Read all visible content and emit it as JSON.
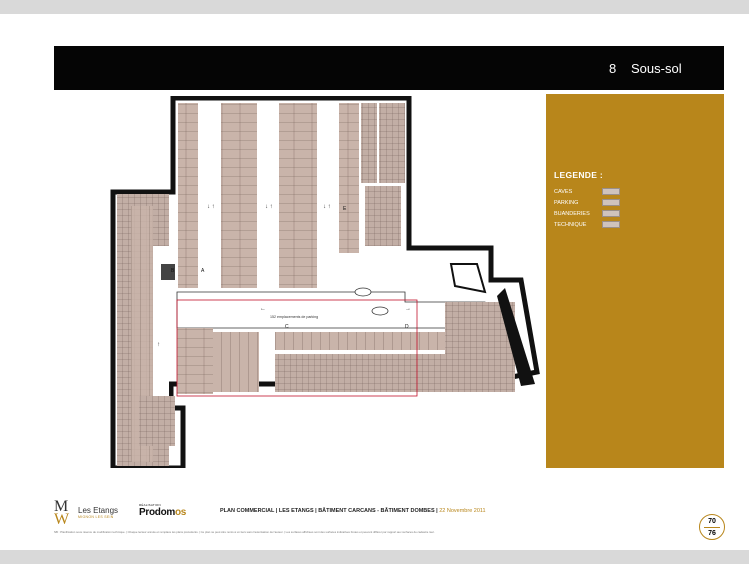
{
  "header": {
    "section_number": "8",
    "section_title": "Sous-sol"
  },
  "legend": {
    "title": "LEGENDE :",
    "items": [
      {
        "label": "CAVES",
        "color": "#cfc3bd"
      },
      {
        "label": "PARKING",
        "color": "#cfc3bd"
      },
      {
        "label": "BUANDERIES",
        "color": "#cfc3bd"
      },
      {
        "label": "TECHNIQUE",
        "color": "#cfc3bd"
      }
    ]
  },
  "plan": {
    "center_label": "152 emplacements de parking",
    "markers": [
      "A",
      "B",
      "C",
      "D",
      "E"
    ]
  },
  "footer": {
    "logo_letters": "MW",
    "brand_name": "Les Etangs",
    "brand_sub": "MIGNON LES SEIN",
    "developer_pre": "RÉALISATION",
    "developer_a": "Prodom",
    "developer_b": "os",
    "plan_line": "PLAN COMMERCIAL | LES ETANGS | BÂTIMENT CARCANS - BÂTIMENT DOMBES |",
    "date": "22 Novembre 2011",
    "disclaimer": "NB : Planification sous réserve de modification technique. | Chaque lecteur annule et remplace les plans précédents. | Ce plan ne peut être remis à un tiers sans l'autorisation de l'auteur. | Les surfaces affichées sont des surfaces indicatives brutes et peuvent différer par rapport aux surfaces de cadastre réel.",
    "page_current": "70",
    "page_total": "76"
  },
  "colors": {
    "accent": "#b8861b",
    "header_bg": "#050505"
  }
}
